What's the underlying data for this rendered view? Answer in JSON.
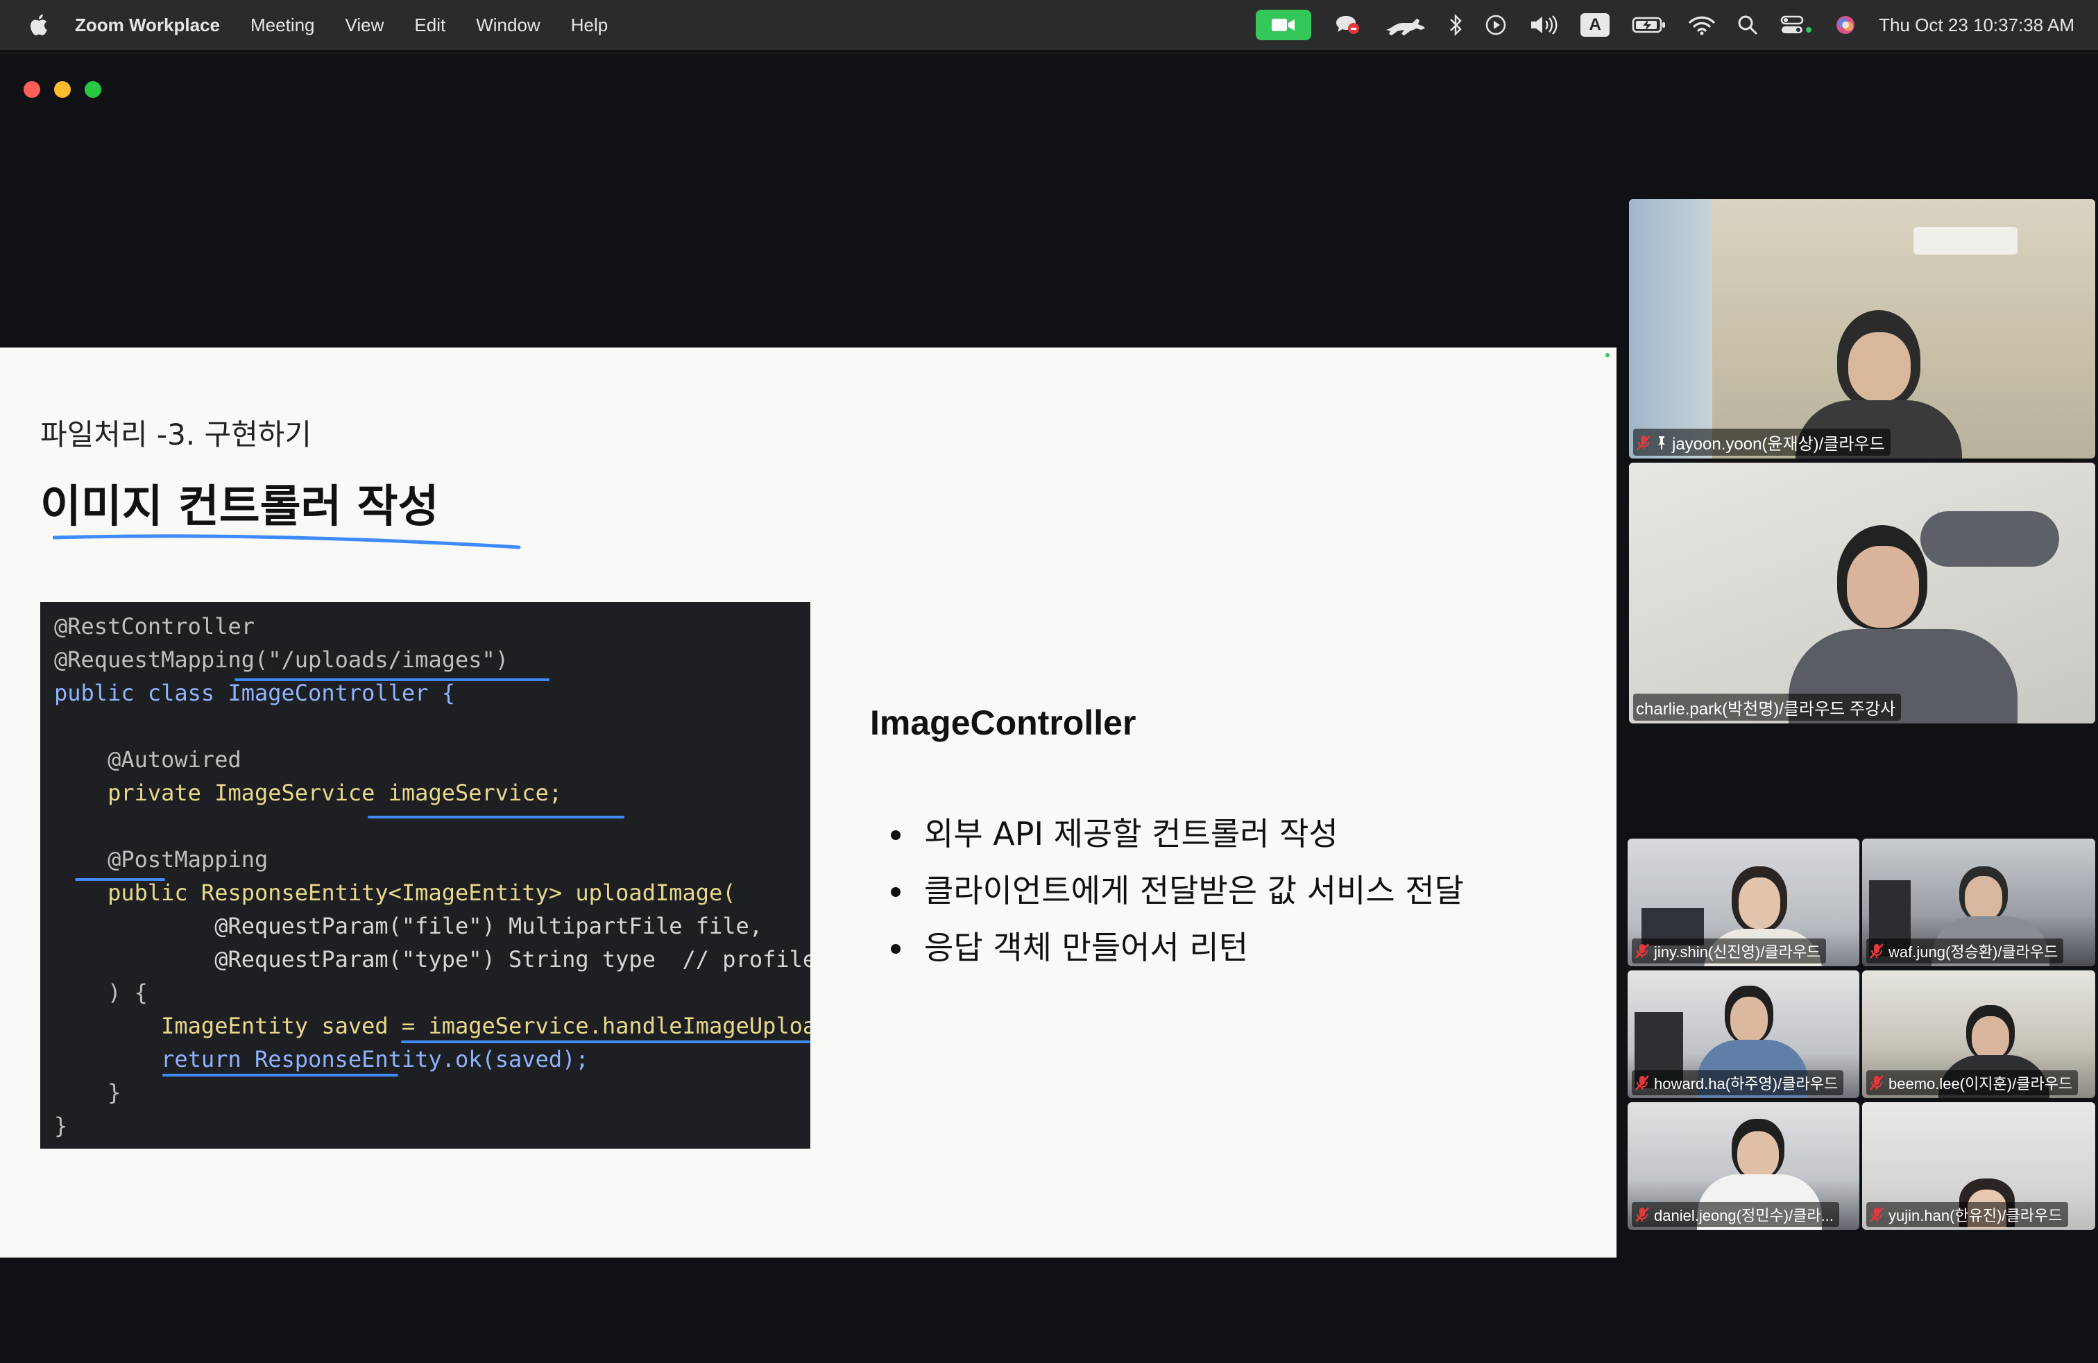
{
  "menubar": {
    "app_name": "Zoom Workplace",
    "menus": [
      "Meeting",
      "View",
      "Edit",
      "Window",
      "Help"
    ],
    "clock": "Thu Oct 23  10:37:38 AM",
    "status_icons": [
      "zoom-video-icon",
      "chat-bubble-icon",
      "cat-icon",
      "bluetooth-icon",
      "play-icon",
      "volume-icon",
      "input-source-icon",
      "battery-icon",
      "wifi-icon",
      "search-icon",
      "control-center-icon",
      "siri-icon"
    ],
    "input_source_label": "A"
  },
  "slide": {
    "breadcrumb": "파일처리 -3. 구현하기",
    "title": "이미지 컨트롤러 작성",
    "heading": "ImageController",
    "bullets": [
      "외부 API 제공할 컨트롤러 작성",
      "클라이언트에게 전달받은 값 서비스 전달",
      "응답 객체 만들어서 리턴"
    ],
    "code_lines": [
      "@RestController",
      "@RequestMapping(\"/uploads/images\")",
      "public class ImageController {",
      "",
      "    @Autowired",
      "    private ImageService imageService;",
      "",
      "    @PostMapping",
      "    public ResponseEntity<ImageEntity> uploadImage(",
      "            @RequestParam(\"file\") MultipartFile file,",
      "            @RequestParam(\"type\") String type  // profile",
      "    ) {",
      "        ImageEntity saved = imageService.handleImageUploa",
      "        return ResponseEntity.ok(saved);",
      "    }",
      "}"
    ]
  },
  "participants": {
    "large": [
      {
        "name": "jayoon.yoon(윤재상)/클라우드",
        "muted": true,
        "pinned": true,
        "active": false
      },
      {
        "name": "charlie.park(박천명)/클라우드 주강사",
        "muted": false,
        "pinned": false,
        "active": true
      }
    ],
    "small": [
      {
        "name": "jiny.shin(신진영)/클라우드",
        "muted": true
      },
      {
        "name": "waf.jung(정승환)/클라우드",
        "muted": true
      },
      {
        "name": "howard.ha(하주영)/클라우드",
        "muted": true
      },
      {
        "name": "beemo.lee(이지훈)/클라우드",
        "muted": true
      },
      {
        "name": "daniel.jeong(정민수)/클라...",
        "muted": true
      },
      {
        "name": "yujin.han(한유진)/클라우드",
        "muted": true
      }
    ]
  },
  "colors": {
    "menubar_bg": "#2a2b2a",
    "window_bg": "#0f1115",
    "slide_bg": "#f9f9f8",
    "code_bg": "#1e1f22",
    "underline_blue": "#3d8bff",
    "active_speaker": "#3fbf4f",
    "muted_red": "#e5383b",
    "zoom_green": "#34c759"
  }
}
